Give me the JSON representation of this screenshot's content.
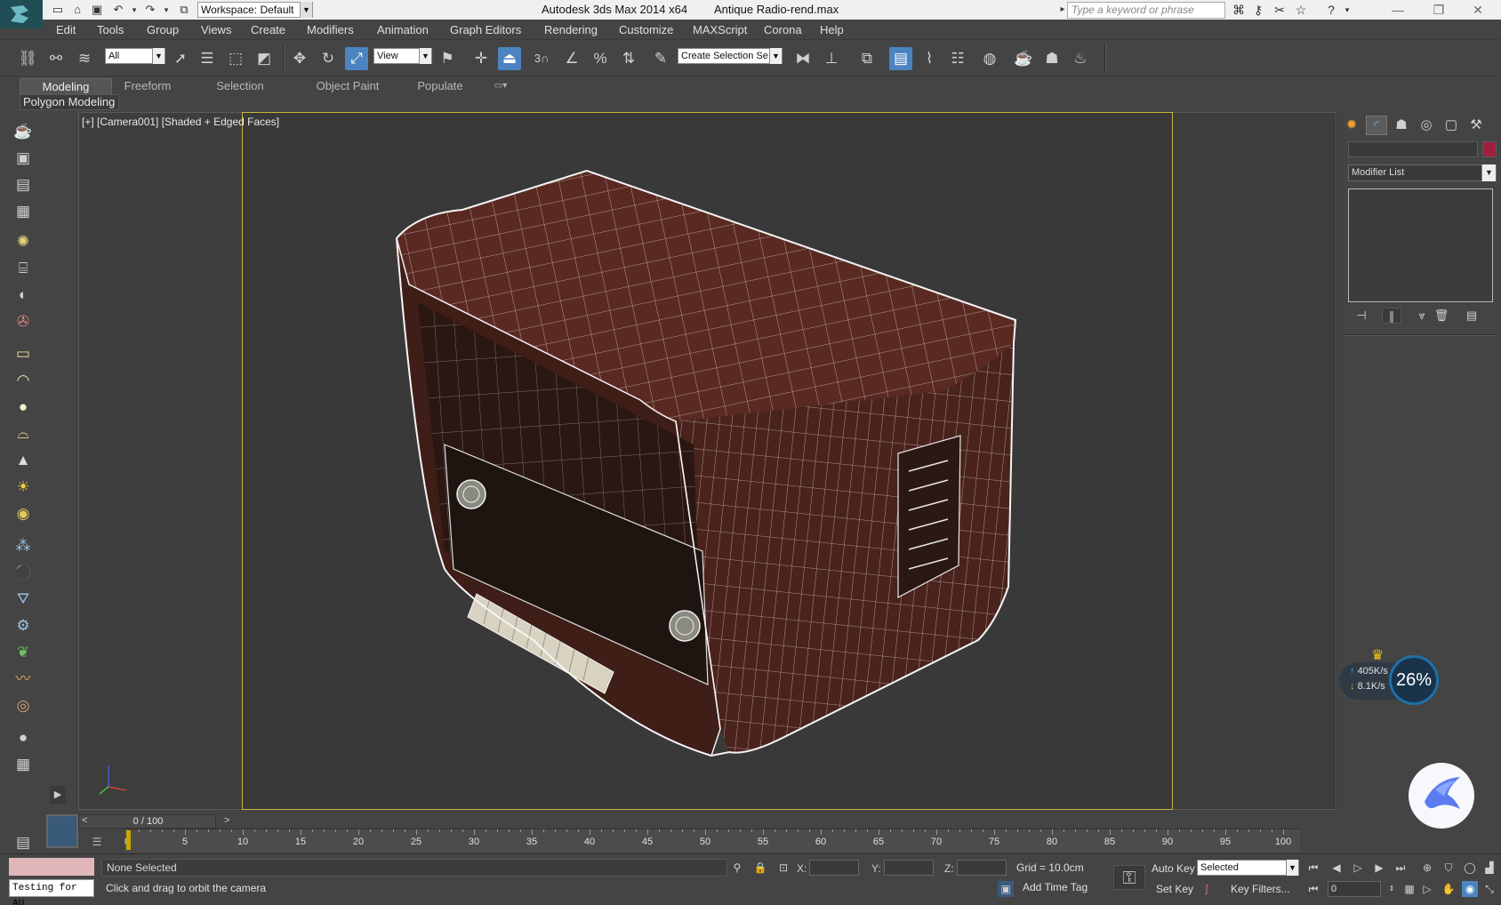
{
  "titlebar": {
    "workspace_label": "Workspace: Default",
    "app_title": "Autodesk 3ds Max  2014 x64",
    "file_title": "Antique Radio-rend.max",
    "search_placeholder": "Type a keyword or phrase"
  },
  "menu": [
    "Edit",
    "Tools",
    "Group",
    "Views",
    "Create",
    "Modifiers",
    "Animation",
    "Graph Editors",
    "Rendering",
    "Customize",
    "MAXScript",
    "Corona",
    "Help"
  ],
  "toolbar": {
    "filter_value": "All",
    "coord_value": "View",
    "snap_angle": "3",
    "selection_set_placeholder": "Create Selection Se"
  },
  "ribbon": {
    "tabs": [
      "Modeling",
      "Freeform",
      "Selection",
      "Object Paint",
      "Populate"
    ],
    "active_tab": "Modeling",
    "panel_label": "Polygon Modeling"
  },
  "viewport": {
    "label": "[+] [Camera001] [Shaded + Edged Faces]",
    "object_colors": {
      "wood": "#5a2a22",
      "wire": "#e8e8e8",
      "safe_frame": "#c9b43c"
    }
  },
  "command_panel": {
    "modifier_list": "Modifier List",
    "object_color": "#a01f3c"
  },
  "network_widget": {
    "upload": "405K/s",
    "download": "8.1K/s",
    "percent": "26%"
  },
  "timeline": {
    "slider_label": "0 / 100",
    "prev": "<",
    "next": ">",
    "ticks": [
      "0",
      "5",
      "10",
      "15",
      "20",
      "25",
      "30",
      "35",
      "40",
      "45",
      "50",
      "55",
      "60",
      "65",
      "70",
      "75",
      "80",
      "85",
      "90",
      "95",
      "100"
    ]
  },
  "statusbar": {
    "maxscript_text": "Testing for AU",
    "selection": "None Selected",
    "prompt": "Click and drag to orbit the camera",
    "x_label": "X:",
    "y_label": "Y:",
    "z_label": "Z:",
    "grid": "Grid = 10.0cm",
    "add_time_tag": "Add Time Tag",
    "auto_key": "Auto Key",
    "set_key": "Set Key",
    "selected_value": "Selected",
    "key_filters": "Key Filters...",
    "current_frame": "0"
  }
}
